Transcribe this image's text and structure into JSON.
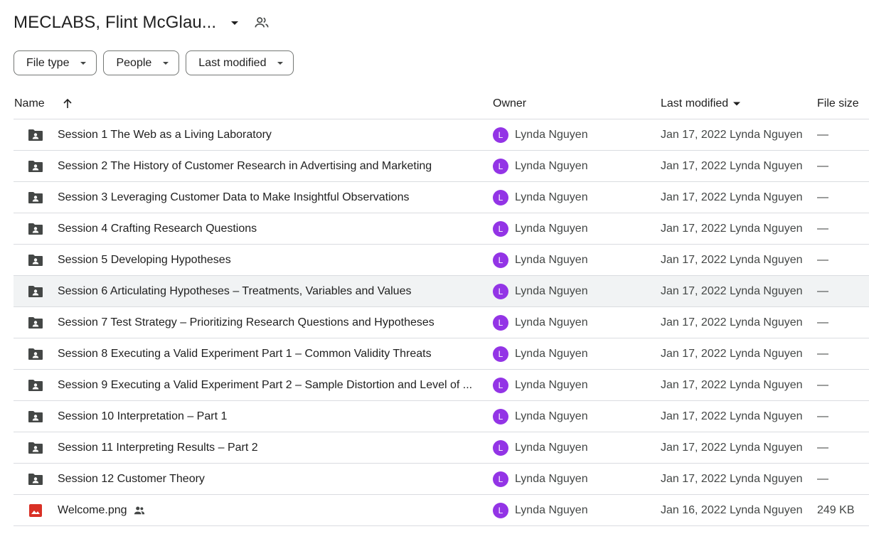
{
  "header": {
    "title": "MECLABS, Flint McGlau...",
    "caret_icon": "arrow-drop-down-icon",
    "shared_icon": "people-outline-icon"
  },
  "filters": [
    {
      "label": "File type"
    },
    {
      "label": "People"
    },
    {
      "label": "Last modified"
    }
  ],
  "columns": {
    "name": "Name",
    "owner": "Owner",
    "last_modified": "Last modified",
    "file_size": "File size"
  },
  "colors": {
    "folder": "#444746",
    "image": "#d93025",
    "avatar": "#9334e6"
  },
  "rows": [
    {
      "name": "Session 1 The Web as a Living Laboratory",
      "type": "folder",
      "owner_initial": "L",
      "owner": "Lynda Nguyen",
      "modified": "Jan 17, 2022 Lynda Nguyen",
      "size": "—"
    },
    {
      "name": "Session 2 The History of Customer Research in Advertising and Marketing",
      "type": "folder",
      "owner_initial": "L",
      "owner": "Lynda Nguyen",
      "modified": "Jan 17, 2022 Lynda Nguyen",
      "size": "—"
    },
    {
      "name": "Session 3 Leveraging Customer Data to Make Insightful Observations",
      "type": "folder",
      "owner_initial": "L",
      "owner": "Lynda Nguyen",
      "modified": "Jan 17, 2022 Lynda Nguyen",
      "size": "—"
    },
    {
      "name": "Session 4 Crafting Research Questions",
      "type": "folder",
      "owner_initial": "L",
      "owner": "Lynda Nguyen",
      "modified": "Jan 17, 2022 Lynda Nguyen",
      "size": "—"
    },
    {
      "name": "Session 5 Developing Hypotheses",
      "type": "folder",
      "owner_initial": "L",
      "owner": "Lynda Nguyen",
      "modified": "Jan 17, 2022 Lynda Nguyen",
      "size": "—"
    },
    {
      "name": "Session 6 Articulating Hypotheses – Treatments, Variables and Values",
      "type": "folder",
      "owner_initial": "L",
      "owner": "Lynda Nguyen",
      "modified": "Jan 17, 2022 Lynda Nguyen",
      "size": "—"
    },
    {
      "name": "Session 7 Test Strategy – Prioritizing Research Questions and Hypotheses",
      "type": "folder",
      "owner_initial": "L",
      "owner": "Lynda Nguyen",
      "modified": "Jan 17, 2022 Lynda Nguyen",
      "size": "—"
    },
    {
      "name": "Session 8 Executing a Valid Experiment Part 1 – Common Validity Threats",
      "type": "folder",
      "owner_initial": "L",
      "owner": "Lynda Nguyen",
      "modified": "Jan 17, 2022 Lynda Nguyen",
      "size": "—"
    },
    {
      "name": "Session 9 Executing a Valid Experiment Part 2 – Sample Distortion and Level of ...",
      "type": "folder",
      "owner_initial": "L",
      "owner": "Lynda Nguyen",
      "modified": "Jan 17, 2022 Lynda Nguyen",
      "size": "—"
    },
    {
      "name": "Session 10 Interpretation – Part 1",
      "type": "folder",
      "owner_initial": "L",
      "owner": "Lynda Nguyen",
      "modified": "Jan 17, 2022 Lynda Nguyen",
      "size": "—"
    },
    {
      "name": "Session 11 Interpreting Results – Part 2",
      "type": "folder",
      "owner_initial": "L",
      "owner": "Lynda Nguyen",
      "modified": "Jan 17, 2022 Lynda Nguyen",
      "size": "—"
    },
    {
      "name": "Session 12 Customer Theory",
      "type": "folder",
      "owner_initial": "L",
      "owner": "Lynda Nguyen",
      "modified": "Jan 17, 2022 Lynda Nguyen",
      "size": "—"
    },
    {
      "name": "Welcome.png",
      "type": "image",
      "shared": true,
      "owner_initial": "L",
      "owner": "Lynda Nguyen",
      "modified": "Jan 16, 2022 Lynda Nguyen",
      "size": "249 KB"
    }
  ]
}
